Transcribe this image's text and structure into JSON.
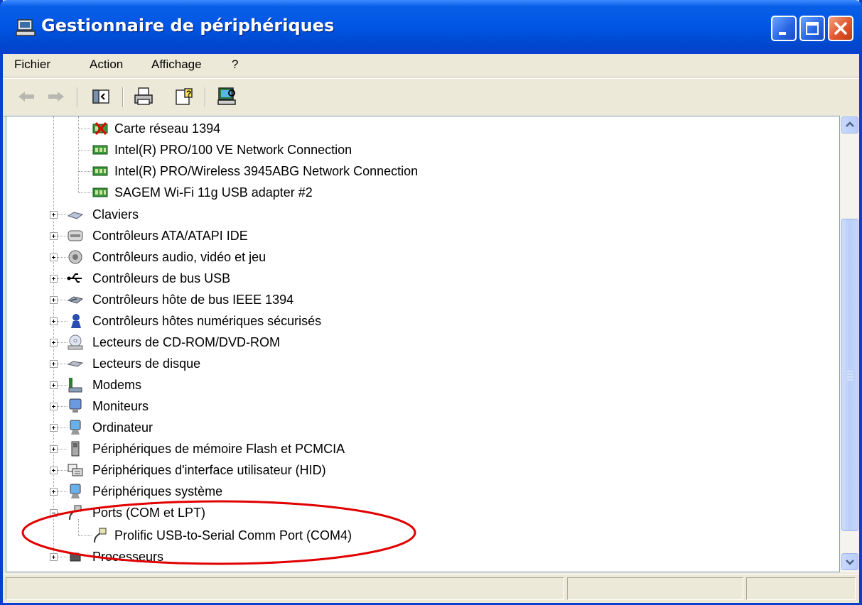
{
  "window": {
    "title": "Gestionnaire de périphériques"
  },
  "menu": {
    "items": [
      "Fichier",
      "Action",
      "Affichage",
      "?"
    ]
  },
  "toolbar": {
    "icons": [
      "back-arrow-icon",
      "forward-arrow-icon",
      "show-hide-console-tree-icon",
      "print-icon",
      "help-icon",
      "scan-hardware-icon"
    ]
  },
  "tree": {
    "network_children": [
      "Carte réseau 1394",
      "Intel(R) PRO/100 VE Network Connection",
      "Intel(R) PRO/Wireless 3945ABG Network Connection",
      "SAGEM Wi-Fi 11g USB adapter #2"
    ],
    "categories": [
      "Claviers",
      "Contrôleurs ATA/ATAPI IDE",
      "Contrôleurs audio, vidéo et jeu",
      "Contrôleurs de bus USB",
      "Contrôleurs hôte de bus IEEE 1394",
      "Contrôleurs hôtes numériques sécurisés",
      "Lecteurs de CD-ROM/DVD-ROM",
      "Lecteurs de disque",
      "Modems",
      "Moniteurs",
      "Ordinateur",
      "Périphériques de mémoire Flash et PCMCIA",
      "Périphériques d'interface utilisateur (HID)",
      "Périphériques système"
    ],
    "ports": {
      "label": "Ports (COM et LPT)",
      "child": "Prolific USB-to-Serial Comm Port (COM4)"
    },
    "last": "Processeurs"
  },
  "colors": {
    "titlebar": "#0055e3",
    "annotation": "#e00000",
    "window_face": "#ece9d8"
  }
}
